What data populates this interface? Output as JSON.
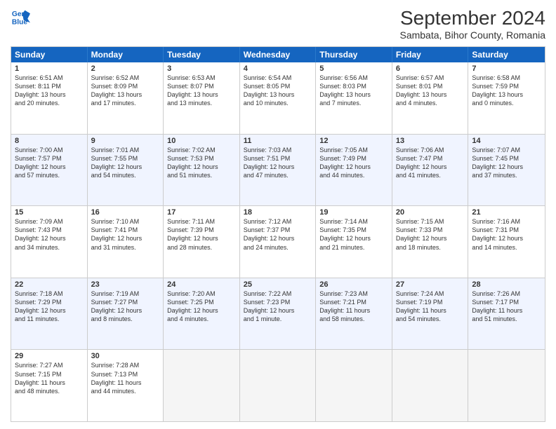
{
  "header": {
    "logo_line1": "General",
    "logo_line2": "Blue",
    "title": "September 2024",
    "subtitle": "Sambata, Bihor County, Romania"
  },
  "weekdays": [
    "Sunday",
    "Monday",
    "Tuesday",
    "Wednesday",
    "Thursday",
    "Friday",
    "Saturday"
  ],
  "rows": [
    {
      "alt": false,
      "cells": [
        {
          "day": "1",
          "lines": [
            "Sunrise: 6:51 AM",
            "Sunset: 8:11 PM",
            "Daylight: 13 hours",
            "and 20 minutes."
          ]
        },
        {
          "day": "2",
          "lines": [
            "Sunrise: 6:52 AM",
            "Sunset: 8:09 PM",
            "Daylight: 13 hours",
            "and 17 minutes."
          ]
        },
        {
          "day": "3",
          "lines": [
            "Sunrise: 6:53 AM",
            "Sunset: 8:07 PM",
            "Daylight: 13 hours",
            "and 13 minutes."
          ]
        },
        {
          "day": "4",
          "lines": [
            "Sunrise: 6:54 AM",
            "Sunset: 8:05 PM",
            "Daylight: 13 hours",
            "and 10 minutes."
          ]
        },
        {
          "day": "5",
          "lines": [
            "Sunrise: 6:56 AM",
            "Sunset: 8:03 PM",
            "Daylight: 13 hours",
            "and 7 minutes."
          ]
        },
        {
          "day": "6",
          "lines": [
            "Sunrise: 6:57 AM",
            "Sunset: 8:01 PM",
            "Daylight: 13 hours",
            "and 4 minutes."
          ]
        },
        {
          "day": "7",
          "lines": [
            "Sunrise: 6:58 AM",
            "Sunset: 7:59 PM",
            "Daylight: 13 hours",
            "and 0 minutes."
          ]
        }
      ]
    },
    {
      "alt": true,
      "cells": [
        {
          "day": "8",
          "lines": [
            "Sunrise: 7:00 AM",
            "Sunset: 7:57 PM",
            "Daylight: 12 hours",
            "and 57 minutes."
          ]
        },
        {
          "day": "9",
          "lines": [
            "Sunrise: 7:01 AM",
            "Sunset: 7:55 PM",
            "Daylight: 12 hours",
            "and 54 minutes."
          ]
        },
        {
          "day": "10",
          "lines": [
            "Sunrise: 7:02 AM",
            "Sunset: 7:53 PM",
            "Daylight: 12 hours",
            "and 51 minutes."
          ]
        },
        {
          "day": "11",
          "lines": [
            "Sunrise: 7:03 AM",
            "Sunset: 7:51 PM",
            "Daylight: 12 hours",
            "and 47 minutes."
          ]
        },
        {
          "day": "12",
          "lines": [
            "Sunrise: 7:05 AM",
            "Sunset: 7:49 PM",
            "Daylight: 12 hours",
            "and 44 minutes."
          ]
        },
        {
          "day": "13",
          "lines": [
            "Sunrise: 7:06 AM",
            "Sunset: 7:47 PM",
            "Daylight: 12 hours",
            "and 41 minutes."
          ]
        },
        {
          "day": "14",
          "lines": [
            "Sunrise: 7:07 AM",
            "Sunset: 7:45 PM",
            "Daylight: 12 hours",
            "and 37 minutes."
          ]
        }
      ]
    },
    {
      "alt": false,
      "cells": [
        {
          "day": "15",
          "lines": [
            "Sunrise: 7:09 AM",
            "Sunset: 7:43 PM",
            "Daylight: 12 hours",
            "and 34 minutes."
          ]
        },
        {
          "day": "16",
          "lines": [
            "Sunrise: 7:10 AM",
            "Sunset: 7:41 PM",
            "Daylight: 12 hours",
            "and 31 minutes."
          ]
        },
        {
          "day": "17",
          "lines": [
            "Sunrise: 7:11 AM",
            "Sunset: 7:39 PM",
            "Daylight: 12 hours",
            "and 28 minutes."
          ]
        },
        {
          "day": "18",
          "lines": [
            "Sunrise: 7:12 AM",
            "Sunset: 7:37 PM",
            "Daylight: 12 hours",
            "and 24 minutes."
          ]
        },
        {
          "day": "19",
          "lines": [
            "Sunrise: 7:14 AM",
            "Sunset: 7:35 PM",
            "Daylight: 12 hours",
            "and 21 minutes."
          ]
        },
        {
          "day": "20",
          "lines": [
            "Sunrise: 7:15 AM",
            "Sunset: 7:33 PM",
            "Daylight: 12 hours",
            "and 18 minutes."
          ]
        },
        {
          "day": "21",
          "lines": [
            "Sunrise: 7:16 AM",
            "Sunset: 7:31 PM",
            "Daylight: 12 hours",
            "and 14 minutes."
          ]
        }
      ]
    },
    {
      "alt": true,
      "cells": [
        {
          "day": "22",
          "lines": [
            "Sunrise: 7:18 AM",
            "Sunset: 7:29 PM",
            "Daylight: 12 hours",
            "and 11 minutes."
          ]
        },
        {
          "day": "23",
          "lines": [
            "Sunrise: 7:19 AM",
            "Sunset: 7:27 PM",
            "Daylight: 12 hours",
            "and 8 minutes."
          ]
        },
        {
          "day": "24",
          "lines": [
            "Sunrise: 7:20 AM",
            "Sunset: 7:25 PM",
            "Daylight: 12 hours",
            "and 4 minutes."
          ]
        },
        {
          "day": "25",
          "lines": [
            "Sunrise: 7:22 AM",
            "Sunset: 7:23 PM",
            "Daylight: 12 hours",
            "and 1 minute."
          ]
        },
        {
          "day": "26",
          "lines": [
            "Sunrise: 7:23 AM",
            "Sunset: 7:21 PM",
            "Daylight: 11 hours",
            "and 58 minutes."
          ]
        },
        {
          "day": "27",
          "lines": [
            "Sunrise: 7:24 AM",
            "Sunset: 7:19 PM",
            "Daylight: 11 hours",
            "and 54 minutes."
          ]
        },
        {
          "day": "28",
          "lines": [
            "Sunrise: 7:26 AM",
            "Sunset: 7:17 PM",
            "Daylight: 11 hours",
            "and 51 minutes."
          ]
        }
      ]
    },
    {
      "alt": false,
      "cells": [
        {
          "day": "29",
          "lines": [
            "Sunrise: 7:27 AM",
            "Sunset: 7:15 PM",
            "Daylight: 11 hours",
            "and 48 minutes."
          ]
        },
        {
          "day": "30",
          "lines": [
            "Sunrise: 7:28 AM",
            "Sunset: 7:13 PM",
            "Daylight: 11 hours",
            "and 44 minutes."
          ]
        },
        {
          "day": "",
          "lines": []
        },
        {
          "day": "",
          "lines": []
        },
        {
          "day": "",
          "lines": []
        },
        {
          "day": "",
          "lines": []
        },
        {
          "day": "",
          "lines": []
        }
      ]
    }
  ]
}
